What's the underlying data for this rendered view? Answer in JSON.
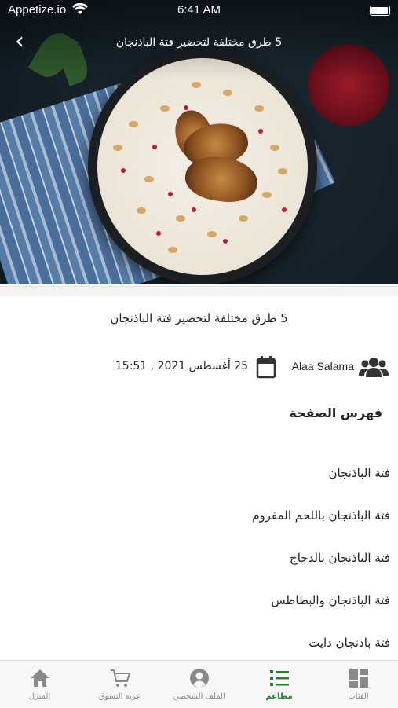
{
  "status_bar": {
    "carrier": "Appetize.io",
    "time": "6:41 AM"
  },
  "nav": {
    "back_glyph": "‹",
    "title": "5 طرق مختلفة لتحضير فتة الباذنجان"
  },
  "article": {
    "title": "5 طرق مختلفة لتحضير فتة الباذنجان",
    "author": "Alaa Salama",
    "date": "25 أغسطس 2021 , 15:51",
    "toc_heading": "فهرس الصفحة",
    "toc_items": [
      "فتة الباذنجان",
      "فتة الباذنجان باللحم المفروم",
      "فتة الباذنجان بالدجاج",
      "فتة الباذنجان والبطاطس",
      "فتة باذنجان دايت"
    ]
  },
  "tabbar": {
    "accent_color": "#2a7b34",
    "inactive_color": "#8a8a8a",
    "tabs": [
      {
        "label": "الفئات",
        "icon": "grid-icon"
      },
      {
        "label": "مطاعم",
        "icon": "list-icon",
        "active": true
      },
      {
        "label": "الملف الشخصي",
        "icon": "profile-icon"
      },
      {
        "label": "عربة التسوق",
        "icon": "cart-icon"
      },
      {
        "label": "المنزل",
        "icon": "home-icon"
      }
    ]
  }
}
